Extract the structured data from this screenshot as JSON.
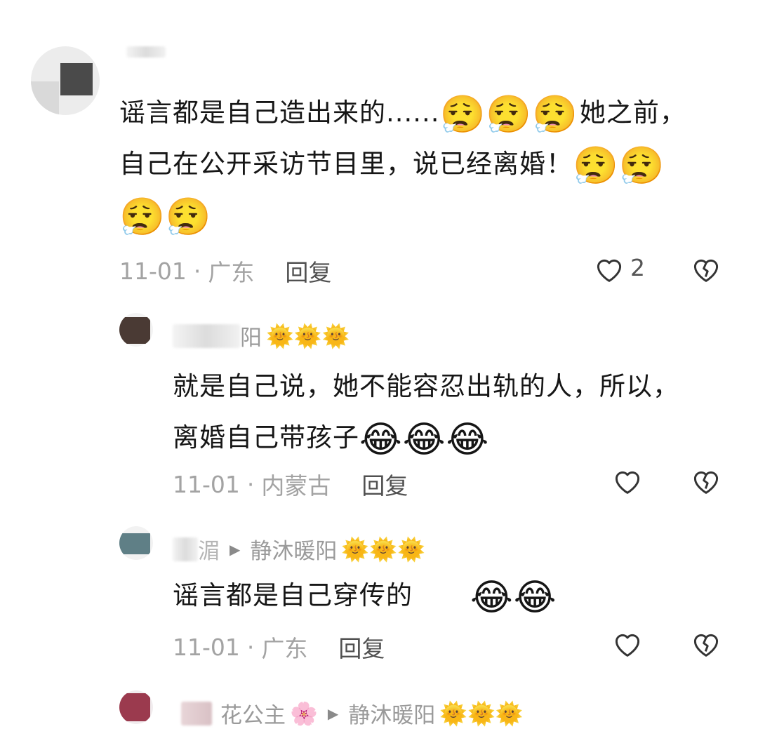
{
  "comments": [
    {
      "name_tail": "",
      "suns": "",
      "text_line1": "谣言都是自己造出来的......",
      "text_line1_emojis": "😮‍💨😮‍💨😮‍💨",
      "text_line1_tail": "她之前，",
      "text_line2": "自己在公开采访节目里，说已经离婚！",
      "text_line2_emojis": "😮‍💨😮‍💨",
      "text_line3_emojis": "😮‍💨😮‍💨",
      "date": "11-01",
      "region": "广东",
      "reply": "回复",
      "like_count": "2"
    },
    {
      "name_tail": "阳",
      "suns": "🌞🌞🌞",
      "text_line1": "就是自己说，她不能容忍出轨的人，所以，",
      "text_line2": "离婚自己带孩子",
      "text_line2_emojis": "😂😂😂",
      "date": "11-01",
      "region": "内蒙古",
      "reply": "回复"
    },
    {
      "name_tail": "湄",
      "reply_to": "静沐暖阳",
      "suns": "🌞🌞🌞",
      "text_line1": "谣言都是自己穿传的",
      "text_line1_emojis": "😂😂",
      "date": "11-01",
      "region": "广东",
      "reply": "回复"
    },
    {
      "name_tail": "花公主",
      "flower": "🌸",
      "reply_to": "静沐暖阳",
      "suns": "🌞🌞🌞"
    }
  ],
  "separator": "·",
  "icons": {
    "like": "heart-outline-icon",
    "dislike": "broken-heart-icon",
    "arrow": "play-arrow-icon"
  }
}
